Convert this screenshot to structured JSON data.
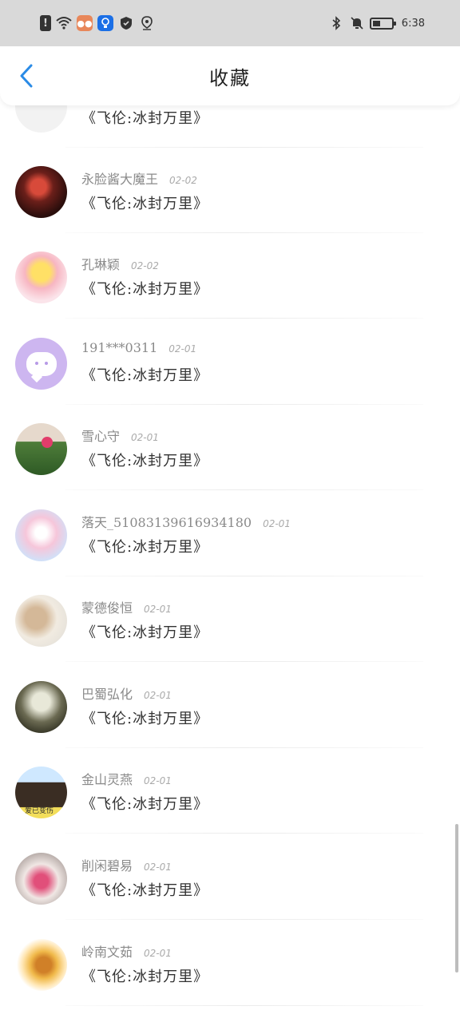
{
  "status_bar": {
    "time": "6:38",
    "icons": [
      "alert-icon",
      "wifi-icon",
      "message-icon",
      "bulb-icon",
      "shield-icon",
      "location-icon",
      "bluetooth-icon",
      "mute-icon",
      "battery-icon"
    ]
  },
  "header": {
    "title": "收藏",
    "back_icon": "chevron-left-icon",
    "accent": "#2a8be6"
  },
  "favorites": [
    {
      "name": "",
      "date": "",
      "work": "《飞伦:冰封万里》"
    },
    {
      "name": "永脸酱大魔王",
      "date": "02-02",
      "work": "《飞伦:冰封万里》"
    },
    {
      "name": "孔琳颖",
      "date": "02-02",
      "work": "《飞伦:冰封万里》"
    },
    {
      "name": "191***0311",
      "date": "02-01",
      "work": "《飞伦:冰封万里》"
    },
    {
      "name": "雪心守",
      "date": "02-01",
      "work": "《飞伦:冰封万里》"
    },
    {
      "name": "落天_51083139616934180",
      "date": "02-01",
      "work": "《飞伦:冰封万里》"
    },
    {
      "name": "蒙德俊恒",
      "date": "02-01",
      "work": "《飞伦:冰封万里》"
    },
    {
      "name": "巴蜀弘化",
      "date": "02-01",
      "work": "《飞伦:冰封万里》"
    },
    {
      "name": "金山灵燕",
      "date": "02-01",
      "work": "《飞伦:冰封万里》"
    },
    {
      "name": "削闲碧易",
      "date": "02-01",
      "work": "《飞伦:冰封万里》"
    },
    {
      "name": "岭南文茹",
      "date": "02-01",
      "work": "《飞伦:冰封万里》"
    }
  ],
  "avatar_tag_text": "爱已变伤"
}
